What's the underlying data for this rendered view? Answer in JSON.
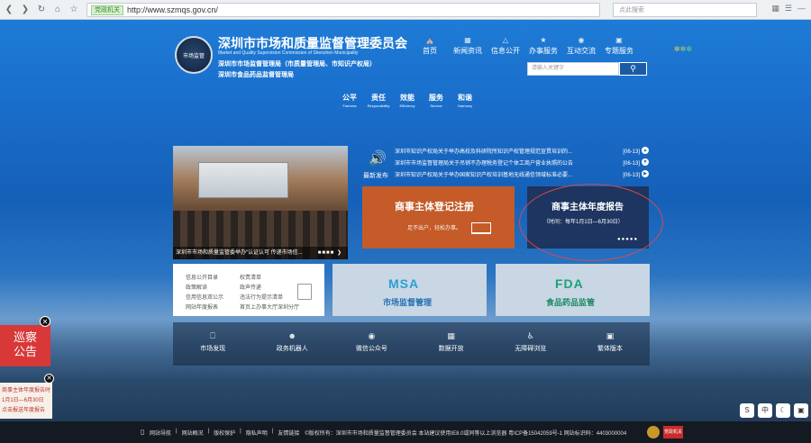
{
  "browser": {
    "trust_badge": "党政机关",
    "url": "http://www.szmqs.gov.cn/",
    "search_placeholder": "点此搜索"
  },
  "header": {
    "title": "深圳市市场和质量监督管理委员会",
    "subtitle_en": "Market and Quality Supervision Commission of Shenzhen Municipality",
    "subtitle2": "深圳市市场监督管理局（市质量管理局、市知识产权局）",
    "subtitle3": "深圳市食品药品监督管理局",
    "emblem_text": "市场监管"
  },
  "nav": [
    {
      "label": "首页",
      "icon": "home-icon"
    },
    {
      "label": "新闻资讯",
      "icon": "news-icon"
    },
    {
      "label": "信息公开",
      "icon": "info-icon"
    },
    {
      "label": "办事服务",
      "icon": "service-icon"
    },
    {
      "label": "互动交流",
      "icon": "chat-icon"
    },
    {
      "label": "专题服务",
      "icon": "topic-icon"
    }
  ],
  "site_search": {
    "placeholder": "请输入关键字"
  },
  "values": [
    {
      "cn": "公平",
      "en": "Fairness"
    },
    {
      "cn": "责任",
      "en": "Responsibility"
    },
    {
      "cn": "效能",
      "en": "Efficiency"
    },
    {
      "cn": "服务",
      "en": "Service"
    },
    {
      "cn": "和谐",
      "en": "Harmony"
    }
  ],
  "photo": {
    "caption": "深圳市市场和质量监管委举办“认证认可 传递市场信..."
  },
  "news": {
    "label": "最新发布",
    "items": [
      {
        "title": "深圳市知识产权局关于举办高校及科研院所知识产权管理规范宣贯培训的...",
        "date": "[06-13]"
      },
      {
        "title": "深圳市市场监督管理局关于吊销不办理税务登记个体工商户营业执照的公告",
        "date": "[06-13]"
      },
      {
        "title": "深圳市知识产权局关于举办国家知识产权培训基地无线通信领域标准必要...",
        "date": "[06-13]"
      }
    ]
  },
  "card_register": {
    "title": "商事主体登记注册",
    "sub": "足不出户，轻松办事。"
  },
  "card_annual": {
    "title": "商事主体年度报告",
    "sub": "（时间：每年1月1日—6月30日）"
  },
  "links": [
    "信息公开目录",
    "权责清单",
    "政策解读",
    "政声传递",
    "信用信息双公示",
    "违法行为提示清单",
    "网站年度报表",
    "首页上办事大厅深圳分厅"
  ],
  "card_msa": {
    "abbr": "MSA",
    "name": "市场监督管理"
  },
  "card_fda": {
    "abbr": "FDA",
    "name": "食品药品监管"
  },
  "quick": [
    {
      "label": "市场发现",
      "icon": "tv-icon"
    },
    {
      "label": "政务机器人",
      "icon": "robot-icon"
    },
    {
      "label": "微信公众号",
      "icon": "wechat-icon"
    },
    {
      "label": "数据开放",
      "icon": "data-icon"
    },
    {
      "label": "无障碍浏览",
      "icon": "accessibility-icon"
    },
    {
      "label": "繁体版本",
      "icon": "traditional-icon"
    }
  ],
  "float1": {
    "line1": "巡察",
    "line2": "公告"
  },
  "float2": {
    "line1": "商事主体年度报告时",
    "line2": "1月1日—6月30日",
    "line3": "点击报送年度报告"
  },
  "footer": {
    "links": [
      "网站导航",
      "网站概况",
      "版权保护",
      "隐私声明",
      "友情链接"
    ],
    "copy": "©版权所有：深圳市市场和质量监督管理委员会 本站建议使用IE8.0或同等以上浏览器 粤ICP备15042059号-1 网站标识码：4403000004",
    "badge": "党政机关"
  },
  "colors": {
    "register": "#c45b28",
    "annual": "#1d3560",
    "accent": "#1d5aa5"
  }
}
